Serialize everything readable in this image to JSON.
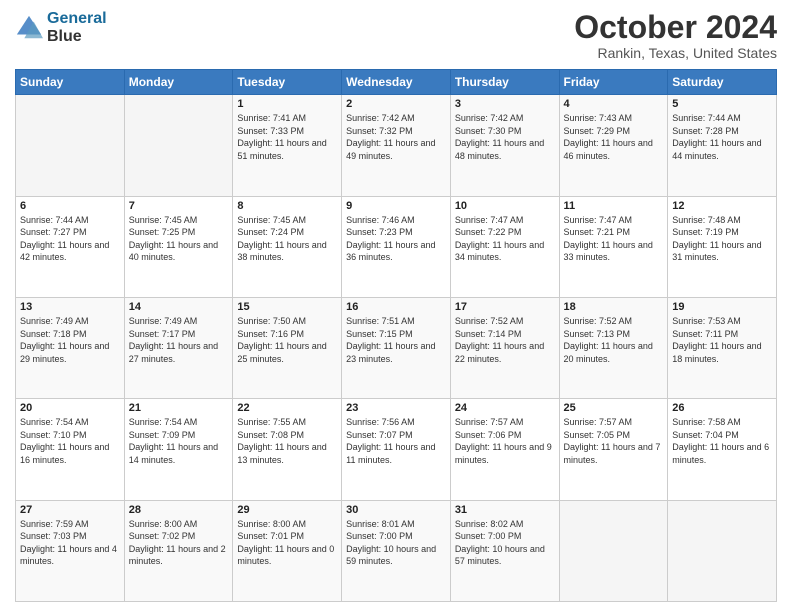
{
  "header": {
    "logo_line1": "General",
    "logo_line2": "Blue",
    "month": "October 2024",
    "location": "Rankin, Texas, United States"
  },
  "days_of_week": [
    "Sunday",
    "Monday",
    "Tuesday",
    "Wednesday",
    "Thursday",
    "Friday",
    "Saturday"
  ],
  "weeks": [
    [
      {
        "day": "",
        "sunrise": "",
        "sunset": "",
        "daylight": ""
      },
      {
        "day": "",
        "sunrise": "",
        "sunset": "",
        "daylight": ""
      },
      {
        "day": "1",
        "sunrise": "Sunrise: 7:41 AM",
        "sunset": "Sunset: 7:33 PM",
        "daylight": "Daylight: 11 hours and 51 minutes."
      },
      {
        "day": "2",
        "sunrise": "Sunrise: 7:42 AM",
        "sunset": "Sunset: 7:32 PM",
        "daylight": "Daylight: 11 hours and 49 minutes."
      },
      {
        "day": "3",
        "sunrise": "Sunrise: 7:42 AM",
        "sunset": "Sunset: 7:30 PM",
        "daylight": "Daylight: 11 hours and 48 minutes."
      },
      {
        "day": "4",
        "sunrise": "Sunrise: 7:43 AM",
        "sunset": "Sunset: 7:29 PM",
        "daylight": "Daylight: 11 hours and 46 minutes."
      },
      {
        "day": "5",
        "sunrise": "Sunrise: 7:44 AM",
        "sunset": "Sunset: 7:28 PM",
        "daylight": "Daylight: 11 hours and 44 minutes."
      }
    ],
    [
      {
        "day": "6",
        "sunrise": "Sunrise: 7:44 AM",
        "sunset": "Sunset: 7:27 PM",
        "daylight": "Daylight: 11 hours and 42 minutes."
      },
      {
        "day": "7",
        "sunrise": "Sunrise: 7:45 AM",
        "sunset": "Sunset: 7:25 PM",
        "daylight": "Daylight: 11 hours and 40 minutes."
      },
      {
        "day": "8",
        "sunrise": "Sunrise: 7:45 AM",
        "sunset": "Sunset: 7:24 PM",
        "daylight": "Daylight: 11 hours and 38 minutes."
      },
      {
        "day": "9",
        "sunrise": "Sunrise: 7:46 AM",
        "sunset": "Sunset: 7:23 PM",
        "daylight": "Daylight: 11 hours and 36 minutes."
      },
      {
        "day": "10",
        "sunrise": "Sunrise: 7:47 AM",
        "sunset": "Sunset: 7:22 PM",
        "daylight": "Daylight: 11 hours and 34 minutes."
      },
      {
        "day": "11",
        "sunrise": "Sunrise: 7:47 AM",
        "sunset": "Sunset: 7:21 PM",
        "daylight": "Daylight: 11 hours and 33 minutes."
      },
      {
        "day": "12",
        "sunrise": "Sunrise: 7:48 AM",
        "sunset": "Sunset: 7:19 PM",
        "daylight": "Daylight: 11 hours and 31 minutes."
      }
    ],
    [
      {
        "day": "13",
        "sunrise": "Sunrise: 7:49 AM",
        "sunset": "Sunset: 7:18 PM",
        "daylight": "Daylight: 11 hours and 29 minutes."
      },
      {
        "day": "14",
        "sunrise": "Sunrise: 7:49 AM",
        "sunset": "Sunset: 7:17 PM",
        "daylight": "Daylight: 11 hours and 27 minutes."
      },
      {
        "day": "15",
        "sunrise": "Sunrise: 7:50 AM",
        "sunset": "Sunset: 7:16 PM",
        "daylight": "Daylight: 11 hours and 25 minutes."
      },
      {
        "day": "16",
        "sunrise": "Sunrise: 7:51 AM",
        "sunset": "Sunset: 7:15 PM",
        "daylight": "Daylight: 11 hours and 23 minutes."
      },
      {
        "day": "17",
        "sunrise": "Sunrise: 7:52 AM",
        "sunset": "Sunset: 7:14 PM",
        "daylight": "Daylight: 11 hours and 22 minutes."
      },
      {
        "day": "18",
        "sunrise": "Sunrise: 7:52 AM",
        "sunset": "Sunset: 7:13 PM",
        "daylight": "Daylight: 11 hours and 20 minutes."
      },
      {
        "day": "19",
        "sunrise": "Sunrise: 7:53 AM",
        "sunset": "Sunset: 7:11 PM",
        "daylight": "Daylight: 11 hours and 18 minutes."
      }
    ],
    [
      {
        "day": "20",
        "sunrise": "Sunrise: 7:54 AM",
        "sunset": "Sunset: 7:10 PM",
        "daylight": "Daylight: 11 hours and 16 minutes."
      },
      {
        "day": "21",
        "sunrise": "Sunrise: 7:54 AM",
        "sunset": "Sunset: 7:09 PM",
        "daylight": "Daylight: 11 hours and 14 minutes."
      },
      {
        "day": "22",
        "sunrise": "Sunrise: 7:55 AM",
        "sunset": "Sunset: 7:08 PM",
        "daylight": "Daylight: 11 hours and 13 minutes."
      },
      {
        "day": "23",
        "sunrise": "Sunrise: 7:56 AM",
        "sunset": "Sunset: 7:07 PM",
        "daylight": "Daylight: 11 hours and 11 minutes."
      },
      {
        "day": "24",
        "sunrise": "Sunrise: 7:57 AM",
        "sunset": "Sunset: 7:06 PM",
        "daylight": "Daylight: 11 hours and 9 minutes."
      },
      {
        "day": "25",
        "sunrise": "Sunrise: 7:57 AM",
        "sunset": "Sunset: 7:05 PM",
        "daylight": "Daylight: 11 hours and 7 minutes."
      },
      {
        "day": "26",
        "sunrise": "Sunrise: 7:58 AM",
        "sunset": "Sunset: 7:04 PM",
        "daylight": "Daylight: 11 hours and 6 minutes."
      }
    ],
    [
      {
        "day": "27",
        "sunrise": "Sunrise: 7:59 AM",
        "sunset": "Sunset: 7:03 PM",
        "daylight": "Daylight: 11 hours and 4 minutes."
      },
      {
        "day": "28",
        "sunrise": "Sunrise: 8:00 AM",
        "sunset": "Sunset: 7:02 PM",
        "daylight": "Daylight: 11 hours and 2 minutes."
      },
      {
        "day": "29",
        "sunrise": "Sunrise: 8:00 AM",
        "sunset": "Sunset: 7:01 PM",
        "daylight": "Daylight: 11 hours and 0 minutes."
      },
      {
        "day": "30",
        "sunrise": "Sunrise: 8:01 AM",
        "sunset": "Sunset: 7:00 PM",
        "daylight": "Daylight: 10 hours and 59 minutes."
      },
      {
        "day": "31",
        "sunrise": "Sunrise: 8:02 AM",
        "sunset": "Sunset: 7:00 PM",
        "daylight": "Daylight: 10 hours and 57 minutes."
      },
      {
        "day": "",
        "sunrise": "",
        "sunset": "",
        "daylight": ""
      },
      {
        "day": "",
        "sunrise": "",
        "sunset": "",
        "daylight": ""
      }
    ]
  ]
}
